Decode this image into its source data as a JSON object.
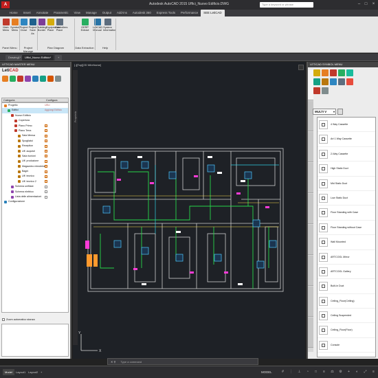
{
  "window": {
    "title": "Autodesk AutoCAD 2015   Uffici_Nuovo Edificio.DWG",
    "search_placeholder": "Type a keyword or phrase",
    "app_button": "A"
  },
  "ribbon_tabs": [
    "Home",
    "Insert",
    "Annotate",
    "Parametric",
    "View",
    "Manage",
    "Output",
    "Add-ins",
    "Autodesk 360",
    "Express Tools",
    "Performance",
    "SEE LetiCAD"
  ],
  "ribbon_active_tab": 11,
  "ribbon": {
    "buttons": [
      {
        "label": "Main Menu",
        "icon": "main-menu-icon",
        "color": "#c0392b"
      },
      {
        "label": "Symbol Menu",
        "icon": "symbol-menu-icon",
        "color": "#e67e22"
      },
      {
        "label": "Project Close",
        "icon": "project-close-icon",
        "color": "#2e86c1"
      },
      {
        "label": "Project Save As",
        "icon": "project-saveas-icon",
        "color": "#1f618d"
      },
      {
        "label": "Building Border",
        "icon": "building-border-icon",
        "color": "#7d3c98"
      },
      {
        "label": "Equipments Place",
        "icon": "equipments-place-icon",
        "color": "#d4ac0d"
      },
      {
        "label": "Controllers Place",
        "icon": "controllers-place-icon",
        "color": "#5d6d7e"
      },
      {
        "label": "GERP Extract",
        "icon": "gerp-extract-icon",
        "color": "#27ae60"
      },
      {
        "label": "LetiCAD Manual",
        "icon": "manual-icon",
        "color": "#2874a6"
      },
      {
        "label": "System Information",
        "icon": "system-info-icon",
        "color": "#5d6d7e"
      }
    ],
    "groups": [
      "Panel Menu",
      "Project Manage",
      "Plan Diagram",
      "Data Extraction",
      "Help"
    ]
  },
  "doc_tabs": [
    "Drawing1*",
    "Uffici_Nuovo Edificio*",
    "+"
  ],
  "doc_active_tab": 1,
  "left_panel": {
    "title": "LETICAD MASTER MENU",
    "logo_a": "Leti",
    "logo_b": "CAD",
    "icons": [
      {
        "name": "project-icon",
        "color": "#e67e22"
      },
      {
        "name": "building-icon",
        "color": "#27ae60"
      },
      {
        "name": "floor-icon",
        "color": "#c0392b"
      },
      {
        "name": "room-icon",
        "color": "#8e44ad"
      },
      {
        "name": "equipment-icon",
        "color": "#2980b9"
      },
      {
        "name": "schema-icon",
        "color": "#16a085"
      },
      {
        "name": "refresh-icon",
        "color": "#d35400"
      },
      {
        "name": "settings-icon",
        "color": "#7f8c8d"
      }
    ],
    "col_category": "Categoria",
    "col_configure": "Configura",
    "tree": [
      {
        "indent": 0,
        "label": "Progetto",
        "conf": "Uffici",
        "sel": false,
        "color": "#e67e22",
        "chk": ""
      },
      {
        "indent": 1,
        "label": "Edifici",
        "conf": "Aggiungi Edificio",
        "sel": true,
        "color": "#27ae60",
        "chk": ""
      },
      {
        "indent": 2,
        "label": "Nuovo Edificio",
        "conf": "",
        "sel": false,
        "color": "#c0392b",
        "chk": ""
      },
      {
        "indent": 3,
        "label": "Copertura",
        "conf": "",
        "sel": false,
        "color": "#c0392b",
        "chk": ""
      },
      {
        "indent": 3,
        "label": "Piano Primo",
        "conf": "",
        "sel": false,
        "color": "#c0392b",
        "chk": "on"
      },
      {
        "indent": 3,
        "label": "Piano Terra",
        "conf": "",
        "sel": false,
        "color": "#c0392b",
        "chk": "on"
      },
      {
        "indent": 4,
        "label": "Sala Mensa",
        "conf": "",
        "sel": false,
        "color": "#b9770e",
        "chk": "on"
      },
      {
        "indent": 4,
        "label": "Spogliatoi",
        "conf": "",
        "sel": false,
        "color": "#b9770e",
        "chk": "on"
      },
      {
        "indent": 4,
        "label": "Reception",
        "conf": "",
        "sel": false,
        "color": "#b9770e",
        "chk": "on"
      },
      {
        "indent": 4,
        "label": "Uff. acquisti",
        "conf": "",
        "sel": false,
        "color": "#b9770e",
        "chk": "on"
      },
      {
        "indent": 4,
        "label": "Sala riunioni",
        "conf": "",
        "sel": false,
        "color": "#b9770e",
        "chk": "on"
      },
      {
        "indent": 4,
        "label": "Uff. produzione",
        "conf": "",
        "sel": false,
        "color": "#b9770e",
        "chk": "on"
      },
      {
        "indent": 4,
        "label": "Magazzino minuteria",
        "conf": "",
        "sel": false,
        "color": "#b9770e",
        "chk": "on"
      },
      {
        "indent": 4,
        "label": "Bagni",
        "conf": "",
        "sel": false,
        "color": "#b9770e",
        "chk": "on"
      },
      {
        "indent": 4,
        "label": "Uff. tecnico",
        "conf": "",
        "sel": false,
        "color": "#b9770e",
        "chk": "on"
      },
      {
        "indent": 4,
        "label": "Uff. tecnico 2",
        "conf": "",
        "sel": false,
        "color": "#b9770e",
        "chk": "on"
      },
      {
        "indent": 2,
        "label": "Schema unifilare",
        "conf": "",
        "sel": false,
        "color": "#8e44ad",
        "chk": "off"
      },
      {
        "indent": 2,
        "label": "Schema elettrico",
        "conf": "",
        "sel": false,
        "color": "#8e44ad",
        "chk": "off"
      },
      {
        "indent": 2,
        "label": "Lista delle alimentazioni",
        "conf": "",
        "sel": false,
        "color": "#8e44ad",
        "chk": "off"
      },
      {
        "indent": 0,
        "label": "Configurazione",
        "conf": "",
        "sel": false,
        "color": "#2980b9",
        "chk": ""
      }
    ],
    "zoom_label": "Zoom automatico stanza"
  },
  "drawing": {
    "viewport_label": "[-][Top][2D Wireframe]",
    "side_label": "Proprietà",
    "cmd_placeholder": "Type a command",
    "axis_x": "X",
    "axis_y": "Y"
  },
  "right_panel": {
    "title": "LETICAD SYMBOL MENU",
    "icon_colors": [
      "#d4ac0d",
      "#e67e22",
      "#c0392b",
      "#27ae60",
      "#1abc9c",
      "#16a085",
      "#b9770e",
      "#2e86c1",
      "#5d6d7e",
      "#e74c3c",
      "#c0392b",
      "#7f8c8d"
    ],
    "dropdown": "MULTI V",
    "symbols": [
      "4 Way Cassette",
      "Art 1 Way Cassette",
      "2-Way Cassette",
      "High Static Duct",
      "Mid Static Duct",
      "Low Static Duct",
      "Floor Standing with Case",
      "Floor Standing without Case",
      "Wall Mounted",
      "ARTCOOL Mirror",
      "ARTCOOL Gallery",
      "Built-in Duct",
      "Ceiling_Floor(Ceiling)",
      "Ceiling Suspended",
      "Ceiling_Floor(Floor)",
      "Console"
    ]
  },
  "status": {
    "tabs": [
      "Model",
      "Layout1",
      "Layout2",
      "+"
    ],
    "active": 0,
    "model_label": "MODEL"
  }
}
